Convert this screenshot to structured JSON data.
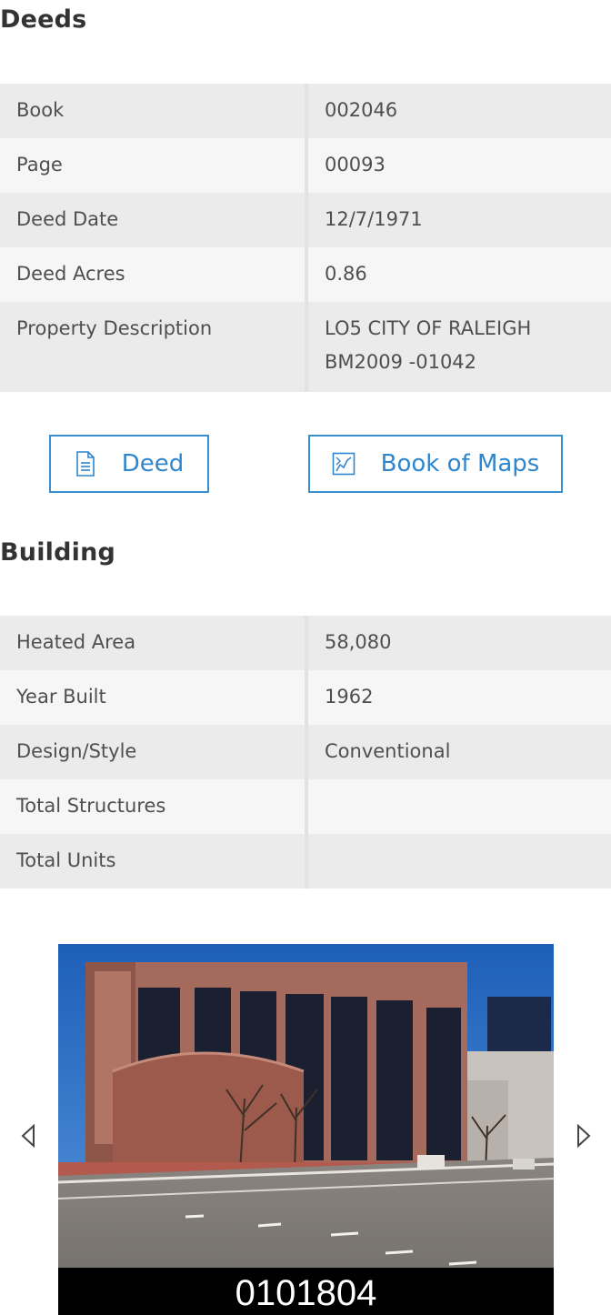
{
  "deeds": {
    "title": "Deeds",
    "rows": [
      {
        "label": "Book",
        "value": "002046"
      },
      {
        "label": "Page",
        "value": "00093"
      },
      {
        "label": "Deed Date",
        "value": "12/7/1971"
      },
      {
        "label": "Deed Acres",
        "value": "0.86"
      },
      {
        "label": "Property Description",
        "value_lines": [
          "LO5 CITY OF RALEIGH",
          "BM2009 -01042"
        ]
      }
    ],
    "buttons": {
      "deed_label": "Deed",
      "maps_label": "Book of Maps"
    }
  },
  "building": {
    "title": "Building",
    "rows": [
      {
        "label": "Heated Area",
        "value": "58,080"
      },
      {
        "label": "Year Built",
        "value": "1962"
      },
      {
        "label": "Design/Style",
        "value": "Conventional"
      },
      {
        "label": "Total Structures",
        "value": ""
      },
      {
        "label": "Total Units",
        "value": ""
      }
    ]
  },
  "photo": {
    "caption": "0101804",
    "icons": {
      "prev": "chevron-left-icon",
      "next": "chevron-right-icon"
    }
  },
  "colors": {
    "accent": "#2f86cc",
    "row_dark": "#ebebeb",
    "row_light": "#f6f6f6"
  }
}
